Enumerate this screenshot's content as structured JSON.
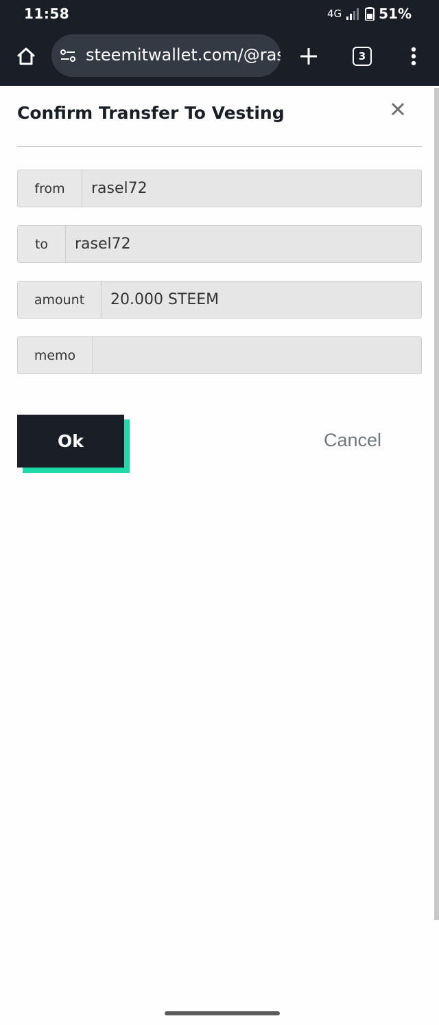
{
  "status_bar": {
    "time": "11:58",
    "network": "4G",
    "battery": "51%"
  },
  "browser": {
    "url": "steemitwallet.com/@ras",
    "tab_count": "3",
    "icons": [
      "home-icon",
      "site-settings-icon",
      "plus-icon",
      "tabs-icon",
      "more-vert-icon"
    ]
  },
  "dialog": {
    "title": "Confirm Transfer To Vesting",
    "fields": [
      {
        "label": "from",
        "value": "rasel72"
      },
      {
        "label": "to",
        "value": "rasel72"
      },
      {
        "label": "amount",
        "value": "20.000 STEEM"
      },
      {
        "label": "memo",
        "value": ""
      }
    ],
    "ok_label": "Ok",
    "cancel_label": "Cancel"
  },
  "colors": {
    "dark": "#1a1f27",
    "accent": "#1fd9a9",
    "field_bg": "#e6e6e6",
    "cancel_text": "#707780"
  }
}
